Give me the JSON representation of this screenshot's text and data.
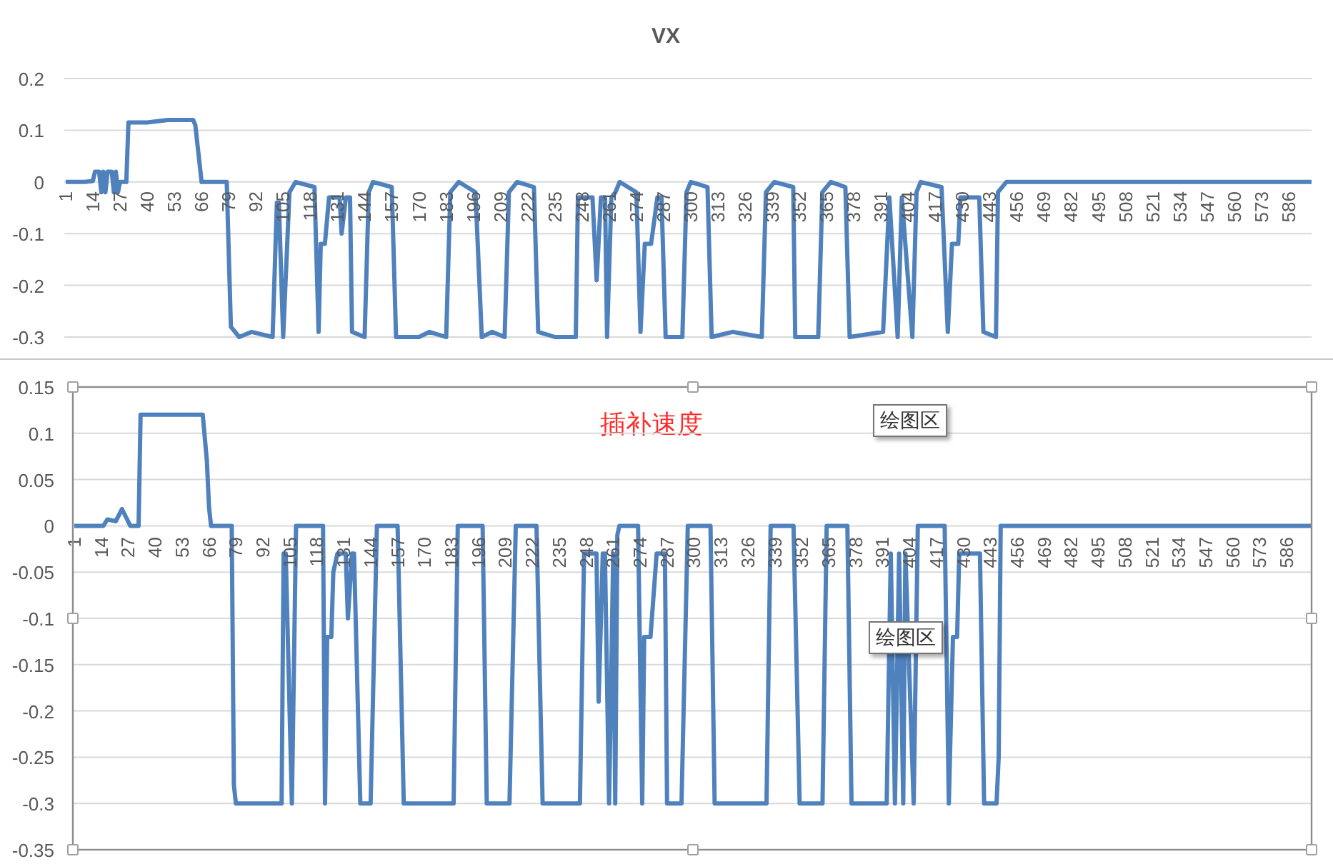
{
  "charts": [
    {
      "selected": false,
      "chart_data": {
        "type": "line",
        "title": "VX",
        "grid": true,
        "xlim": [
          1,
          597
        ],
        "ylim": [
          -0.3,
          0.2
        ],
        "yticks": [
          0.2,
          0.1,
          0,
          -0.1,
          -0.2,
          -0.3
        ],
        "xticks": [
          1,
          14,
          27,
          40,
          53,
          66,
          79,
          92,
          105,
          118,
          131,
          144,
          157,
          170,
          183,
          196,
          209,
          222,
          235,
          248,
          261,
          274,
          287,
          300,
          313,
          326,
          339,
          352,
          365,
          378,
          391,
          404,
          417,
          430,
          443,
          456,
          469,
          482,
          495,
          508,
          521,
          534,
          547,
          560,
          573,
          586
        ],
        "x": [
          1,
          10,
          14,
          15,
          17,
          18,
          19,
          20,
          21,
          23,
          24,
          25,
          26,
          27,
          30,
          31,
          40,
          50,
          62,
          63,
          66,
          78,
          80,
          84,
          90,
          100,
          102,
          103,
          105,
          108,
          111,
          120,
          122,
          123,
          125,
          127,
          132,
          133,
          135,
          137,
          138,
          144,
          146,
          148,
          157,
          159,
          170,
          175,
          183,
          185,
          189,
          197,
          200,
          205,
          211,
          213,
          217,
          225,
          227,
          235,
          245,
          246,
          253,
          255,
          257,
          259,
          260,
          262,
          264,
          266,
          274,
          276,
          278,
          281,
          284,
          286,
          288,
          296,
          298,
          300,
          308,
          310,
          320,
          334,
          336,
          340,
          349,
          350,
          361,
          363,
          367,
          374,
          376,
          392,
          395,
          399,
          401,
          406,
          408,
          410,
          420,
          423,
          425,
          428,
          429,
          438,
          440,
          446,
          447,
          451,
          597
        ],
        "series": [
          {
            "color": "#4f81bd",
            "values": [
              0,
              0,
              0.002,
              0.02,
              0.02,
              -0.02,
              0.02,
              -0.02,
              0.02,
              0.02,
              -0.02,
              0.02,
              -0.02,
              0,
              0,
              0.115,
              0.115,
              0.12,
              0.12,
              0.11,
              0,
              0,
              -0.28,
              -0.3,
              -0.29,
              -0.3,
              -0.04,
              -0.04,
              -0.3,
              -0.02,
              0,
              -0.01,
              -0.29,
              -0.12,
              -0.12,
              -0.03,
              -0.03,
              -0.1,
              -0.03,
              -0.03,
              -0.29,
              -0.3,
              -0.02,
              0,
              -0.01,
              -0.3,
              -0.3,
              -0.29,
              -0.3,
              -0.02,
              0,
              -0.02,
              -0.3,
              -0.29,
              -0.3,
              -0.02,
              0,
              -0.01,
              -0.29,
              -0.3,
              -0.3,
              -0.03,
              -0.03,
              -0.19,
              -0.03,
              -0.03,
              -0.3,
              -0.03,
              -0.02,
              0,
              -0.02,
              -0.29,
              -0.12,
              -0.12,
              -0.03,
              -0.03,
              -0.3,
              -0.3,
              -0.02,
              0,
              -0.01,
              -0.3,
              -0.29,
              -0.3,
              -0.02,
              0,
              -0.01,
              -0.3,
              -0.3,
              -0.02,
              0,
              -0.01,
              -0.3,
              -0.29,
              -0.03,
              -0.3,
              -0.03,
              -0.3,
              -0.02,
              0,
              -0.01,
              -0.29,
              -0.12,
              -0.12,
              -0.03,
              -0.03,
              -0.29,
              -0.3,
              -0.02,
              0,
              0
            ]
          }
        ]
      }
    },
    {
      "selected": true,
      "tooltips": [
        "绘图区",
        "绘图区"
      ],
      "chart_data": {
        "type": "line",
        "title": "插补速度",
        "grid": true,
        "xlim": [
          1,
          598
        ],
        "ylim": [
          -0.35,
          0.15
        ],
        "yticks": [
          0.15,
          0.1,
          0.05,
          0,
          -0.05,
          -0.1,
          -0.15,
          -0.2,
          -0.25,
          -0.3,
          -0.35
        ],
        "xticks": [
          1,
          14,
          27,
          40,
          53,
          66,
          79,
          92,
          105,
          118,
          131,
          144,
          157,
          170,
          183,
          196,
          209,
          222,
          235,
          248,
          261,
          274,
          287,
          300,
          313,
          326,
          339,
          352,
          365,
          378,
          391,
          404,
          417,
          430,
          443,
          456,
          469,
          482,
          495,
          508,
          521,
          534,
          547,
          560,
          573,
          586
        ],
        "x": [
          1,
          15,
          17,
          21,
          24,
          28,
          32,
          33,
          63,
          65,
          66,
          67,
          77,
          78,
          79,
          101,
          102,
          103,
          106,
          108,
          121,
          122,
          123,
          125,
          126,
          128,
          132,
          133,
          135,
          136,
          139,
          144,
          147,
          157,
          160,
          184,
          186,
          198,
          200,
          211,
          214,
          224,
          227,
          245,
          247,
          253,
          254,
          256,
          257,
          259,
          261,
          262,
          263,
          264,
          273,
          275,
          276,
          279,
          282,
          286,
          287,
          294,
          297,
          308,
          310,
          335,
          337,
          348,
          351,
          362,
          364,
          374,
          376,
          393,
          395,
          397,
          399,
          401,
          402,
          406,
          408,
          421,
          423,
          425,
          427,
          428,
          438,
          440,
          446,
          447,
          448,
          598
        ],
        "series": [
          {
            "color": "#4f81bd",
            "values": [
              0,
              0,
              0.007,
              0.005,
              0.018,
              0,
              0,
              0.12,
              0.12,
              0.07,
              0.02,
              0,
              0,
              -0.28,
              -0.3,
              -0.3,
              -0.03,
              -0.03,
              -0.3,
              0,
              0,
              -0.3,
              -0.12,
              -0.12,
              -0.05,
              -0.03,
              -0.03,
              -0.1,
              -0.03,
              -0.03,
              -0.3,
              -0.3,
              0,
              0,
              -0.3,
              -0.3,
              0,
              0,
              -0.3,
              -0.3,
              0,
              0,
              -0.3,
              -0.3,
              -0.03,
              -0.03,
              -0.19,
              -0.03,
              -0.03,
              -0.3,
              -0.03,
              -0.3,
              -0.01,
              0,
              0,
              -0.3,
              -0.12,
              -0.12,
              -0.03,
              -0.03,
              -0.3,
              -0.3,
              0,
              0,
              -0.3,
              -0.3,
              0,
              0,
              -0.3,
              -0.3,
              0,
              0,
              -0.3,
              -0.3,
              -0.03,
              -0.3,
              -0.03,
              -0.3,
              -0.03,
              -0.3,
              0,
              0,
              -0.3,
              -0.12,
              -0.12,
              -0.03,
              -0.03,
              -0.3,
              -0.3,
              -0.25,
              0,
              0
            ]
          }
        ]
      }
    }
  ]
}
